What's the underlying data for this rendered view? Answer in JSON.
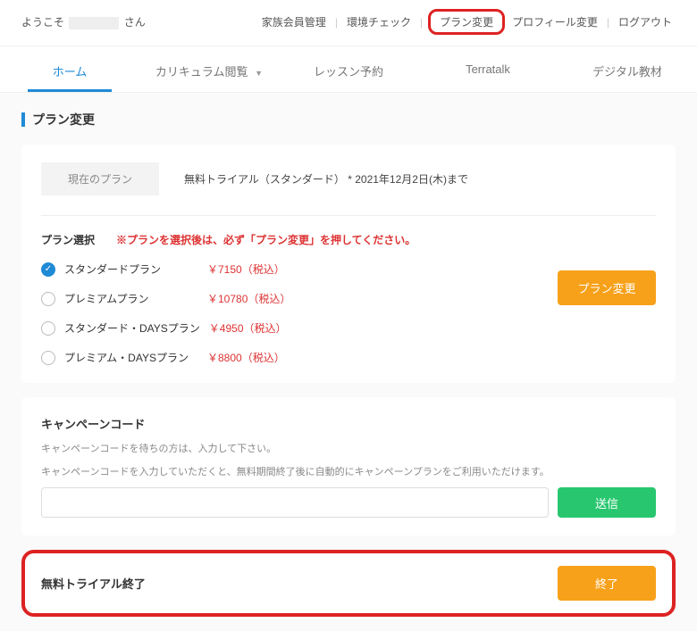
{
  "header": {
    "greeting_prefix": "ようこそ",
    "greeting_suffix": "さん",
    "nav": {
      "family": "家族会員管理",
      "envcheck": "環境チェック",
      "planchange": "プラン変更",
      "profile": "プロフィール変更",
      "logout": "ログアウト"
    }
  },
  "tabs": {
    "home": "ホーム",
    "curriculum": "カリキュラム閲覧",
    "lesson": "レッスン予約",
    "terratalk": "Terratalk",
    "digital": "デジタル教材"
  },
  "section_title": "プラン変更",
  "current_plan": {
    "label": "現在のプラン",
    "value": "無料トライアル（スタンダード） * 2021年12月2日(木)まで"
  },
  "plan_select": {
    "label": "プラン選択",
    "warning": "※プランを選択後は、必ず「プラン変更」を押してください。"
  },
  "plans": [
    {
      "name": "スタンダードプラン",
      "price": "￥7150（税込）",
      "selected": true
    },
    {
      "name": "プレミアムプラン",
      "price": "￥10780（税込）",
      "selected": false
    },
    {
      "name": "スタンダード・DAYSプラン",
      "price": "￥4950（税込）",
      "selected": false
    },
    {
      "name": "プレミアム・DAYSプラン",
      "price": "￥8800（税込）",
      "selected": false
    }
  ],
  "buttons": {
    "plan_change": "プラン変更",
    "send": "送信",
    "end": "終了"
  },
  "campaign": {
    "title": "キャンペーンコード",
    "note1": "キャンペーンコードを待ちの方は、入力して下さい。",
    "note2": "キャンペーンコードを入力していただくと、無料期間終了後に自動的にキャンペーンプランをご利用いただけます。",
    "placeholder": ""
  },
  "trial_end": {
    "label": "無料トライアル終了"
  }
}
